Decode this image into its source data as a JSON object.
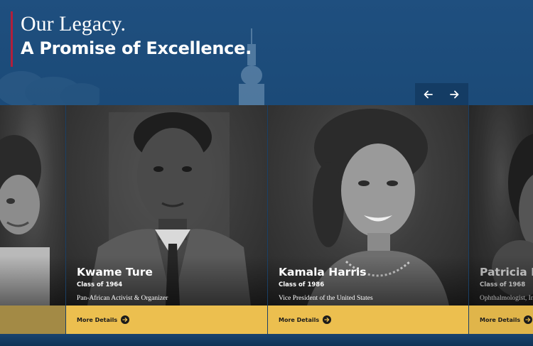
{
  "hero": {
    "line1": "Our Legacy.",
    "line2": "A Promise of Excellence."
  },
  "nav": {
    "prev_icon": "arrow-left-icon",
    "next_icon": "arrow-right-icon"
  },
  "colors": {
    "background": "#1d4a78",
    "accent_bar": "#ecbf4f",
    "heading_rule": "#b21f3b"
  },
  "cards": [
    {
      "name": "Kwame Ture",
      "class_year": "Class of 1964",
      "title": "Pan-African Activist & Organizer",
      "cta": "More Details"
    },
    {
      "name": "Kamala Harris",
      "class_year": "Class of 1986",
      "title": "Vice President of the United States",
      "cta": "More Details"
    },
    {
      "name": "Patricia Bath",
      "class_year": "Class of 1968",
      "title": "Ophthalmologist, Inventor",
      "cta": "More Details"
    }
  ]
}
